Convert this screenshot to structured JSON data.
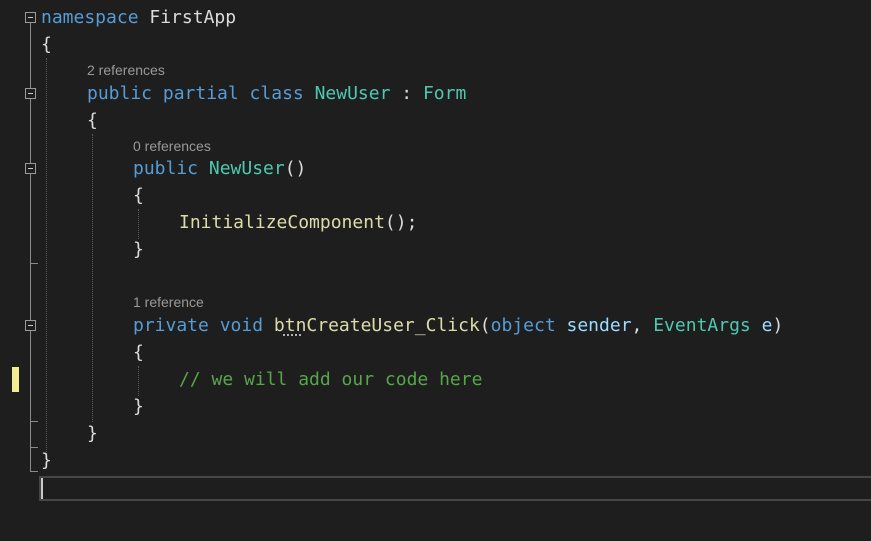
{
  "code_lens": {
    "class_refs": "2 references",
    "ctor_refs": "0 references",
    "handler_refs": "1 reference"
  },
  "code": {
    "l1_kw": "namespace",
    "l1_name": " FirstApp",
    "open_brace": "{",
    "close_brace": "}",
    "l3_kw": "public partial class ",
    "l3_type": "NewUser",
    "l3_sep": " : ",
    "l3_base": "Form",
    "l5_kw": "public ",
    "l5_name": "NewUser",
    "l5_parens": "()",
    "l7_call": "InitializeComponent",
    "l7_end": "();",
    "l10_kw": "private void ",
    "l10_name": "btnCreateUser_Click",
    "l10_open": "(",
    "l10_objkw": "object",
    "l10_sender": " sender",
    "l10_comma": ", ",
    "l10_argtype": "EventArgs",
    "l10_e": " e",
    "l10_close": ")",
    "l12_comment": "// we will add our code here"
  },
  "colors": {
    "background": "#1e1e1e",
    "keyword": "#569cd6",
    "type": "#4ec9b0",
    "method": "#dcdcaa",
    "parameter": "#9cdcfe",
    "comment": "#57a64a",
    "text": "#dcdcdc",
    "code_lens": "#999999",
    "change_bar": "#efef91"
  },
  "icons": {
    "fold": "collapse-minus-icon"
  }
}
